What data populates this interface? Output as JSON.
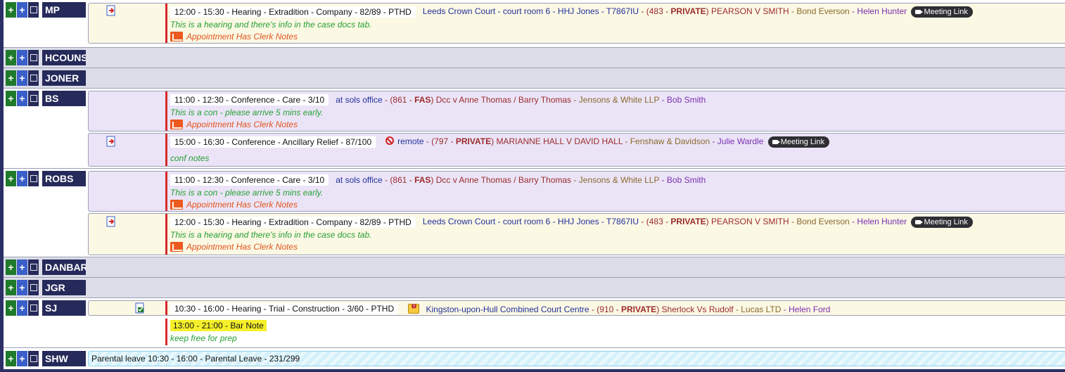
{
  "ui": {
    "add_symbol": "+",
    "clerk_note_text": "Appointment Has Clerk Notes",
    "meeting_link_label": "Meeting Link"
  },
  "rows": {
    "mp": {
      "name": "MP",
      "appt1": {
        "time": "12:00 - 15:30 - Hearing - Extradition - Company - 82/89 - PTHD",
        "court": "Leeds Crown Court - court room 6 - HHJ Jones - T7867IU",
        "case_pre": "- (483 - ",
        "case_priv": "PRIVATE",
        "case_post": ") PEARSON V SMITH",
        "solicitor": "- Bond Everson",
        "client": "- Helen Hunter",
        "note": "This is a hearing and there's info in the case docs tab."
      }
    },
    "hcouns": {
      "name": "HCOUNS"
    },
    "joner": {
      "name": "JONER"
    },
    "bs": {
      "name": "BS",
      "appt1": {
        "time": "11:00 - 12:30 - Conference - Care - 3/10",
        "court": "at sols office",
        "case_pre": "- (861 - ",
        "case_priv": "FAS",
        "case_post": ") Dcc v Anne Thomas / Barry Thomas",
        "solicitor": "- Jensons & White LLP",
        "client": "- Bob Smith",
        "note": "This is a con - please arrive 5 mins early."
      },
      "appt2": {
        "time": "15:00 - 16:30 - Conference - Ancillary Relief - 87/100",
        "court": "remote",
        "case_pre": "- (797 - ",
        "case_priv": "PRIVATE",
        "case_post": ") MARIANNE HALL V DAVID HALL",
        "solicitor": "- Fenshaw & Davidson",
        "client": "- Julie Wardle",
        "note": "conf notes"
      }
    },
    "robs": {
      "name": "ROBS",
      "appt1": {
        "time": "11:00 - 12:30 - Conference - Care - 3/10",
        "court": "at sols office",
        "case_pre": "- (861 - ",
        "case_priv": "FAS",
        "case_post": ") Dcc v Anne Thomas / Barry Thomas",
        "solicitor": "- Jensons & White LLP",
        "client": "- Bob Smith",
        "note": "This is a con - please arrive 5 mins early."
      },
      "appt2": {
        "time": "12:00 - 15:30 - Hearing - Extradition - Company - 82/89 - PTHD",
        "court": "Leeds Crown Court - court room 6 - HHJ Jones - T7867IU",
        "case_pre": "- (483 - ",
        "case_priv": "PRIVATE",
        "case_post": ") PEARSON V SMITH",
        "solicitor": "- Bond Everson",
        "client": "- Helen Hunter",
        "note": "This is a hearing and there's info in the case docs tab."
      }
    },
    "danbar": {
      "name": "DANBAR"
    },
    "jgr": {
      "name": "JGR"
    },
    "sj": {
      "name": "SJ",
      "appt1": {
        "time": "10:30 - 16:00 - Hearing - Trial - Construction - 3/60 - PTHD",
        "court": "Kingston-upon-Hull Combined Court Centre",
        "case_pre": "- (910 - ",
        "case_priv": "PRIVATE",
        "case_post": ") Sherlock Vs Rudolf",
        "solicitor": "- Lucas LTD",
        "client": "- Helen Ford"
      },
      "bar_note": {
        "time": "13:00 - 21:00 - Bar Note",
        "note": "keep free for prep"
      }
    },
    "shw": {
      "name": "SHW",
      "leave": "Parental leave 10:30 - 16:00 - Parental Leave - 231/299"
    }
  },
  "colors": {
    "name_bg": "#262a5a",
    "add_green": "#1f7a2c",
    "add_blue": "#3a5fc8",
    "hearing_bg": "#fbf8e4",
    "conference_bg": "#ebe4f7",
    "leave_stripe": "#d4f0fb",
    "red_bar": "#d62b2b",
    "note_green": "#27a035",
    "clerk_orange": "#e2541a",
    "bar_note_highlight": "#f5f02a"
  }
}
